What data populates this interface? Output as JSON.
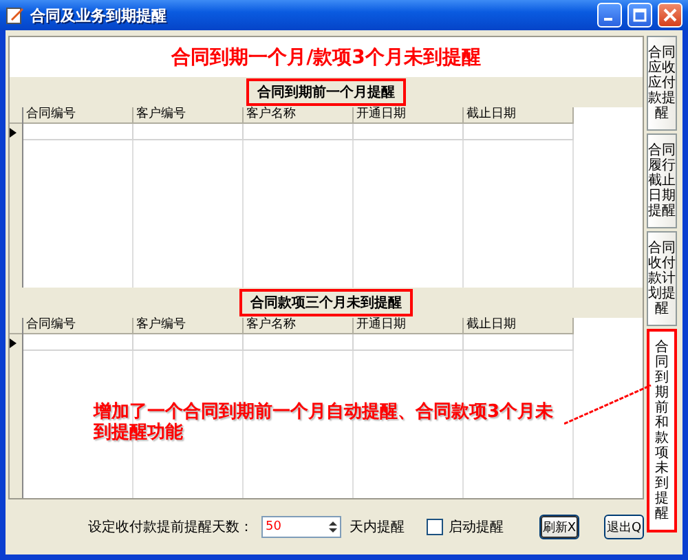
{
  "window": {
    "title": "合同及业务到期提醒"
  },
  "heading": "合同到期一个月/款项3个月未到提醒",
  "sections": [
    {
      "title": "合同到期前一个月提醒",
      "highlighted": true,
      "columns": [
        "合同编号",
        "客户编号",
        "客户名称",
        "开通日期",
        "截止日期"
      ]
    },
    {
      "title": "合同款项三个月未到提醒",
      "highlighted": true,
      "columns": [
        "合同编号",
        "客户编号",
        "客户名称",
        "开通日期",
        "截止日期"
      ]
    }
  ],
  "side_tabs": [
    {
      "label": "合同应收应付款提醒",
      "selected": false
    },
    {
      "label": "合同履行截止日期提醒",
      "selected": false
    },
    {
      "label": "合同收付款计划提醒",
      "selected": false
    },
    {
      "label": "合同到期前和款项未到提醒",
      "selected": true
    }
  ],
  "annotation": "增加了一个合同到期前一个月自动提醒、合同款项3个月未到提醒功能",
  "footer": {
    "days_label": "设定收付款提前提醒天数：",
    "days_value": "50",
    "days_suffix": "天内提醒",
    "auto_remind": {
      "label": "启动提醒",
      "checked": false
    },
    "buttons": [
      {
        "label": "刷新X",
        "default": true
      },
      {
        "label": "退出Q",
        "default": false
      }
    ]
  }
}
